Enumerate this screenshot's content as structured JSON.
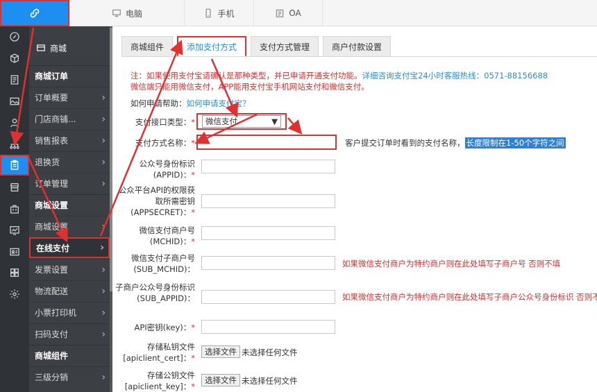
{
  "topbar": {
    "tabs": [
      {
        "label": "电脑",
        "icon": "monitor-icon"
      },
      {
        "label": "手机",
        "icon": "phone-icon"
      },
      {
        "label": "OA",
        "icon": "calendar-icon"
      }
    ]
  },
  "rail": {
    "icons": [
      "link-icon",
      "cube-icon",
      "document-icon",
      "image-icon",
      "user-icon",
      "network-icon",
      "clipboard-icon",
      "store-icon",
      "bag-icon",
      "chart-icon",
      "id-card-icon",
      "grid-icon",
      "gear-icon"
    ],
    "active_index": 6
  },
  "submenu": {
    "store_label": "商城",
    "sections": [
      {
        "type": "head",
        "label": "商城订单"
      },
      {
        "type": "item",
        "label": "订单概要"
      },
      {
        "type": "item",
        "label": "门店商铺..."
      },
      {
        "type": "item",
        "label": "销售报表"
      },
      {
        "type": "item",
        "label": "退换货"
      },
      {
        "type": "item",
        "label": "订单管理"
      },
      {
        "type": "head",
        "label": "商城设置"
      },
      {
        "type": "item",
        "label": "商城设置"
      },
      {
        "type": "item",
        "label": "在线支付",
        "active": true
      },
      {
        "type": "item",
        "label": "发票设置"
      },
      {
        "type": "item",
        "label": "物流配送"
      },
      {
        "type": "item",
        "label": "小票打印机"
      },
      {
        "type": "item",
        "label": "扫码支付"
      },
      {
        "type": "head",
        "label": "商城组件"
      },
      {
        "type": "item",
        "label": "三级分销"
      }
    ]
  },
  "main": {
    "tabs": [
      "商城组件",
      "添加支付方式",
      "支付方式管理",
      "商户付款设置"
    ],
    "active_tab": 1,
    "notice_line1": "注：如果使用支付宝请确认是那种类型，并已申请开通支付功能。",
    "notice_line1_link": "详细咨询支付宝24小时客服热线：0571-88156688",
    "notice_line2": "微信端只能用微信支付，APP能用支付宝手机网站支付和微信支付。",
    "help_prefix": "如何申请帮助：",
    "help_link": "如何申请支付宝？",
    "form": {
      "pay_type_label": "支付接口类型：",
      "pay_type_value": "微信支付",
      "pay_name_label": "支付方式名称：",
      "pay_name_hint": "客户提交订单时看到的支付名称，",
      "pay_name_hint_selected": "长度限制在1-50个字符之间",
      "appid_label": "公众号身份标识(APPID)：",
      "appsecret_label": "公众平台API的权限获取所需密钥(APPSECRET)：",
      "mchid_label": "微信支付商户号(MCHID)：",
      "sub_mchid_label": "微信支付子商户号(SUB_MCHID)：",
      "sub_mchid_hint": "如果微信支付商户为特约商户则在此处填写子商户号 否则不填",
      "sub_appid_label": "子商户公众号身份标识(SUB_APPID)：",
      "sub_appid_hint": "如果微信支付商户为特约商户则在此处填写子商户公众号身份标识 否则不填",
      "apikey_label": "API密钥(key)：",
      "cert_label": "存储私钥文件[apiclient_cert]：",
      "key_label": "存储公钥文件[apiclient_key]：",
      "file_button": "选择文件",
      "no_file": "未选择任何文件"
    }
  },
  "colors": {
    "accent": "#1d8ff0",
    "annotation": "#e03030",
    "link": "#2a8fd8"
  }
}
